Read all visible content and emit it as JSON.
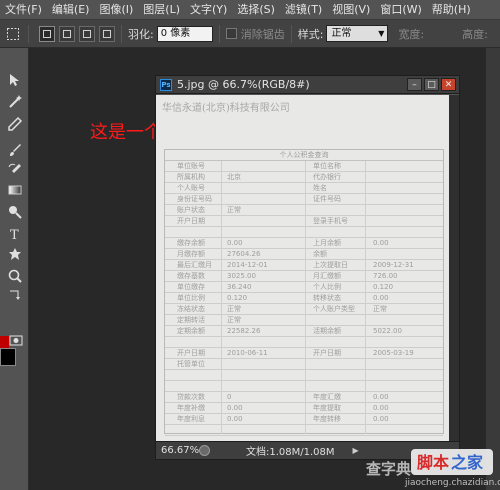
{
  "menu": {
    "items": [
      "文件(F)",
      "编辑(E)",
      "图像(I)",
      "图层(L)",
      "文字(Y)",
      "选择(S)",
      "滤镜(T)",
      "视图(V)",
      "窗口(W)",
      "帮助(H)"
    ]
  },
  "options": {
    "feather_label": "羽化:",
    "feather_value": "0 像素",
    "antialias_label": "消除锯齿",
    "style_label": "样式:",
    "style_value": "正常",
    "width_label": "宽度:",
    "height_label": "高度:"
  },
  "toolbox": {
    "fg_color": "#c00000",
    "bg_color": "#000000"
  },
  "annotation": {
    "text": "这是一个颜色很浅的扫描文件",
    "color": "#ff1a1a"
  },
  "document": {
    "title": "5.jpg @ 66.7%(RGB/8#)",
    "ps_badge": "Ps",
    "zoom": "66.67%",
    "info": "文档:1.08M/1.08M",
    "scan": {
      "company": "华信永道(北京)科技有限公司",
      "form_title": "个人公积金查询",
      "rows": [
        [
          "单位账号",
          "",
          "单位名称",
          ""
        ],
        [
          "所属机构",
          "北京",
          "代办银行",
          ""
        ],
        [
          "个人账号",
          "",
          "姓名",
          ""
        ],
        [
          "身份证号码",
          "",
          "证件号码",
          ""
        ],
        [
          "账户状态",
          "正常",
          "",
          ""
        ],
        [
          "开户日期",
          "",
          "登录手机号",
          ""
        ],
        [
          "",
          "",
          "",
          ""
        ],
        [
          "缴存余额",
          "0.00",
          "上月余额",
          "0.00"
        ],
        [
          "月缴存额",
          "27604.26",
          "余额",
          ""
        ],
        [
          "最后汇缴月",
          "2014-12-01",
          "上次提取日",
          "2009-12-31"
        ],
        [
          "缴存基数",
          "3025.00",
          "月汇缴额",
          "726.00"
        ],
        [
          "单位缴存",
          "36.240",
          "个人比例",
          "0.120"
        ],
        [
          "单位比例",
          "0.120",
          "转移状态",
          "0.00"
        ],
        [
          "冻结状态",
          "正常",
          "个人账户类型",
          "正常"
        ],
        [
          "定期转活",
          "正常",
          "",
          ""
        ],
        [
          "定期余额",
          "22582.26",
          "活期余额",
          "5022.00"
        ],
        [
          "",
          "",
          "",
          ""
        ],
        [
          "开户日期",
          "2010-06-11",
          "开户日期",
          "2005-03-19"
        ],
        [
          "托管单位",
          "",
          "",
          ""
        ],
        [
          "",
          "",
          "",
          ""
        ],
        [
          "",
          "",
          "",
          ""
        ],
        [
          "贷款次数",
          "0",
          "年度汇缴",
          "0.00"
        ],
        [
          "年度补缴",
          "0.00",
          "年度提取",
          "0.00"
        ],
        [
          "年度利息",
          "0.00",
          "年度转移",
          "0.00"
        ],
        [
          "",
          "",
          "",
          ""
        ]
      ]
    }
  },
  "watermark": {
    "main": "查字典",
    "url": "jiaocheng.chazidian.com",
    "badge": "脚本之家"
  }
}
